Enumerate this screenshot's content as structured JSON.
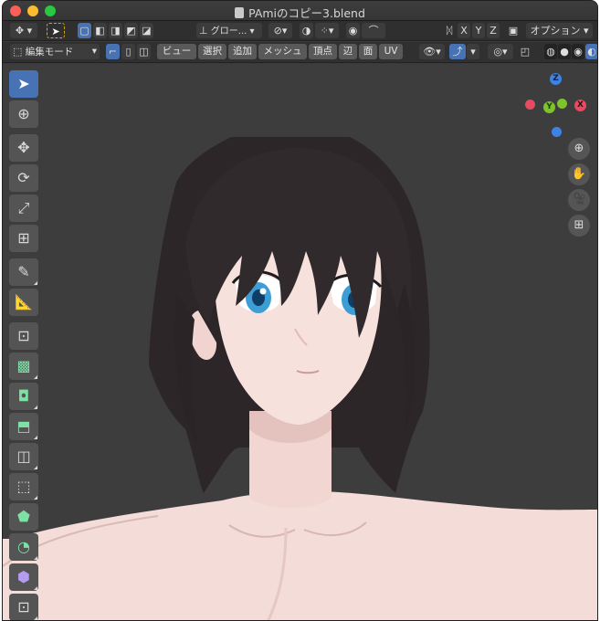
{
  "window": {
    "title": "PAmiのコピー3.blend"
  },
  "header1": {
    "transform_orientation": "グロー...",
    "axes": [
      "X",
      "Y",
      "Z"
    ],
    "options_label": "オプション"
  },
  "header2": {
    "mode": "編集モード",
    "menus": [
      "ビュー",
      "選択",
      "追加",
      "メッシュ",
      "頂点",
      "辺",
      "面",
      "UV"
    ]
  },
  "gizmo": {
    "x_label": "X",
    "y_label": "Y",
    "z_label": "Z"
  },
  "colors": {
    "accent": "#4772b3",
    "x_axis": "#e84a5f",
    "y_axis": "#7ec22c",
    "z_axis": "#3f82e3"
  },
  "icons": {
    "select": "cursor-icon",
    "cursor": "target-icon",
    "move": "move-icon",
    "rotate": "rotate-icon",
    "scale": "scale-icon",
    "transform": "transform-icon",
    "annotate": "pencil-icon",
    "measure": "ruler-icon",
    "add_cube": "add-cube-icon",
    "extrude": "extrude-icon",
    "inset": "inset-icon",
    "bevel": "bevel-icon",
    "loopcut": "loopcut-icon",
    "knife": "knife-icon",
    "polybuild": "polybuild-icon",
    "spin": "spin-icon",
    "smooth": "smooth-icon",
    "shrink": "shrink-icon",
    "zoom": "zoom-icon",
    "pan": "hand-icon",
    "camera": "camera-icon",
    "perspective": "grid-icon"
  }
}
